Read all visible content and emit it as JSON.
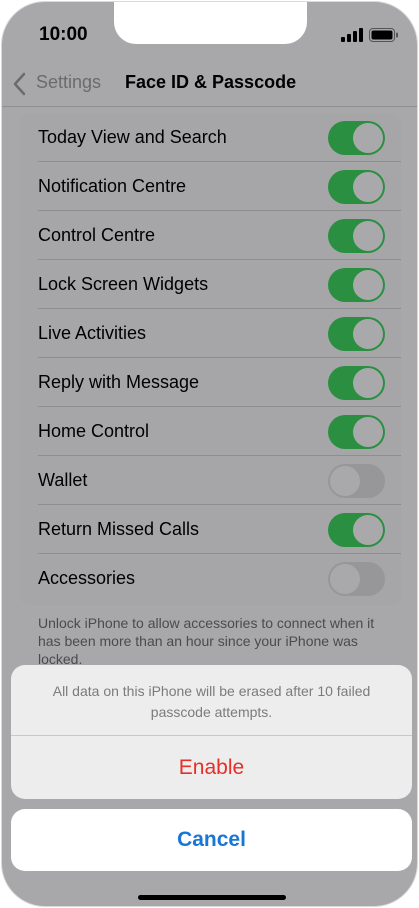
{
  "status": {
    "time": "10:00"
  },
  "nav": {
    "back_label": "Settings",
    "title": "Face ID & Passcode"
  },
  "settings": [
    {
      "label": "Today View and Search",
      "on": true
    },
    {
      "label": "Notification Centre",
      "on": true
    },
    {
      "label": "Control Centre",
      "on": true
    },
    {
      "label": "Lock Screen Widgets",
      "on": true
    },
    {
      "label": "Live Activities",
      "on": true
    },
    {
      "label": "Reply with Message",
      "on": true
    },
    {
      "label": "Home Control",
      "on": true
    },
    {
      "label": "Wallet",
      "on": false
    },
    {
      "label": "Return Missed Calls",
      "on": true
    },
    {
      "label": "Accessories",
      "on": false
    }
  ],
  "footer_note": "Unlock iPhone to allow accessories to connect when it has been more than an hour since your iPhone was locked.",
  "action_sheet": {
    "message": "All data on this iPhone will be erased after 10 failed passcode attempts.",
    "enable_label": "Enable",
    "cancel_label": "Cancel"
  },
  "colors": {
    "toggle_on": "#2a8f41",
    "destructive": "#e5302a",
    "accent": "#1877d4"
  },
  "icons": [
    "signal-icon",
    "battery-icon",
    "chevron-left-icon"
  ]
}
